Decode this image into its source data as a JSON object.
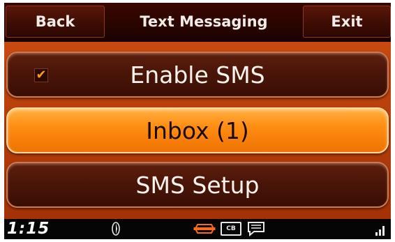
{
  "header": {
    "back_label": "Back",
    "title": "Text Messaging",
    "exit_label": "Exit"
  },
  "menu": {
    "items": [
      {
        "label": "Enable SMS",
        "checked": true,
        "selected": false
      },
      {
        "label": "Inbox (1)",
        "selected": true
      },
      {
        "label": "SMS Setup",
        "selected": false
      }
    ]
  },
  "status_bar": {
    "time": "1:15",
    "cb_label": "CB",
    "icons": [
      "compass-icon",
      "harley-logo-icon",
      "cb-radio-icon",
      "message-icon",
      "signal-strength-icon"
    ]
  },
  "colors": {
    "accent": "#ff8e13",
    "background": "#b43c0a",
    "header": "#2a0500"
  }
}
